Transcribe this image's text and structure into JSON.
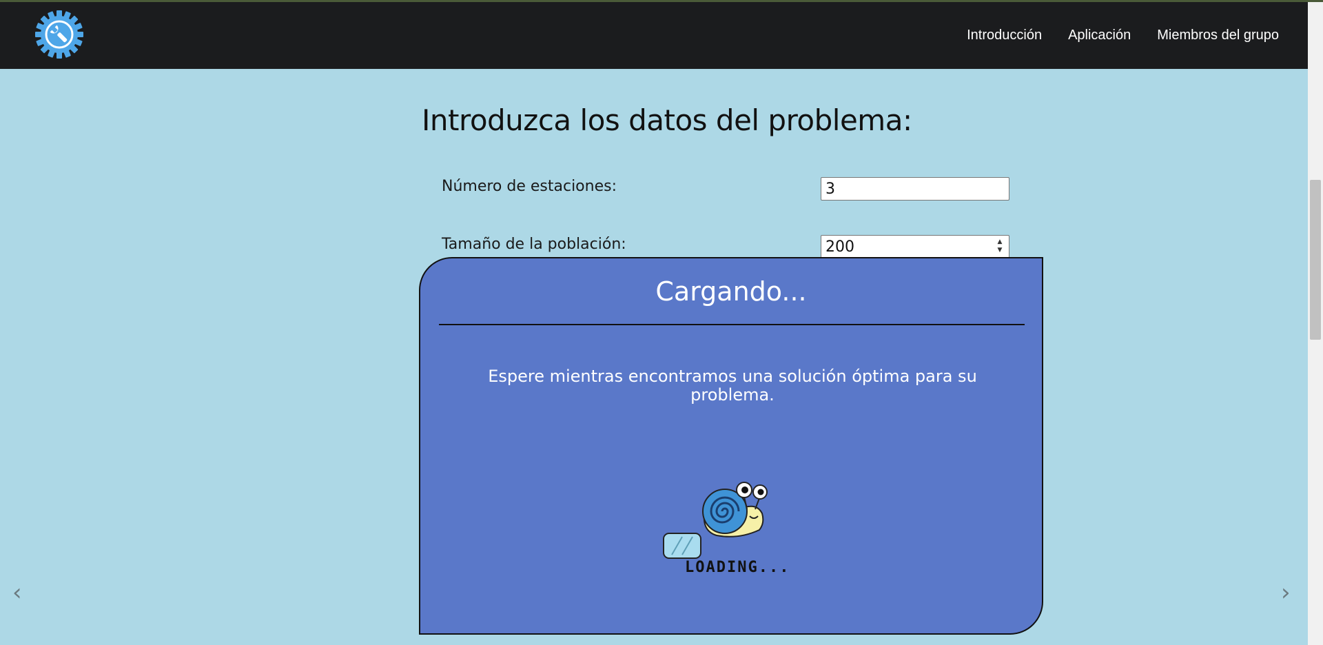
{
  "nav": {
    "logo_icon": "gear-wrench-icon",
    "links": [
      "Introducción",
      "Aplicación",
      "Miembros del grupo"
    ]
  },
  "form": {
    "title": "Introduzca los datos del problema:",
    "fields": [
      {
        "label": "Número de estaciones:",
        "value": "3"
      },
      {
        "label": "Tamaño de la población:",
        "value": "200"
      }
    ]
  },
  "carousel": {
    "prev": "‹",
    "next": "›"
  },
  "modal": {
    "title": "Cargando...",
    "message": "Espere mientras encontramos una solución óptima para su problema.",
    "loader_text": "LOADING..."
  },
  "colors": {
    "background": "#add8e6",
    "navbar": "#1b1c1e",
    "modal": "#5a78c9",
    "logo": "#4ea6e8"
  }
}
